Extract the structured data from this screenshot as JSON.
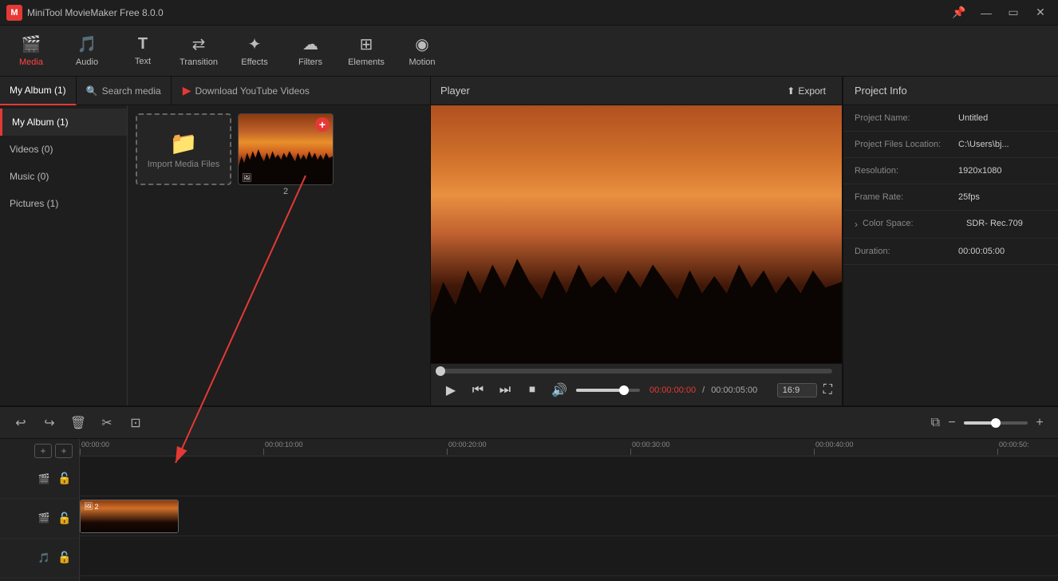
{
  "app": {
    "title": "MiniTool MovieMaker Free 8.0.0",
    "logo": "M"
  },
  "titlebar": {
    "title": "MiniTool MovieMaker Free 8.0.0"
  },
  "toolbar": {
    "items": [
      {
        "id": "media",
        "label": "Media",
        "icon": "🎬",
        "active": true
      },
      {
        "id": "audio",
        "label": "Audio",
        "icon": "🎵",
        "active": false
      },
      {
        "id": "text",
        "label": "Text",
        "icon": "T",
        "active": false
      },
      {
        "id": "transition",
        "label": "Transition",
        "icon": "⇄",
        "active": false
      },
      {
        "id": "effects",
        "label": "Effects",
        "icon": "✦",
        "active": false
      },
      {
        "id": "filters",
        "label": "Filters",
        "icon": "☁",
        "active": false
      },
      {
        "id": "elements",
        "label": "Elements",
        "icon": "⊞",
        "active": false
      },
      {
        "id": "motion",
        "label": "Motion",
        "icon": "◉",
        "active": false
      }
    ]
  },
  "leftpanel": {
    "tabs": [
      {
        "id": "myalbum",
        "label": "My Album (1)",
        "active": true
      },
      {
        "id": "search",
        "label": "Search media",
        "active": false
      },
      {
        "id": "download",
        "label": "Download YouTube Videos",
        "active": false
      }
    ],
    "sidebar": [
      {
        "id": "myalbum",
        "label": "My Album (1)",
        "active": true
      },
      {
        "id": "videos",
        "label": "Videos (0)",
        "active": false
      },
      {
        "id": "music",
        "label": "Music (0)",
        "active": false
      },
      {
        "id": "pictures",
        "label": "Pictures (1)",
        "active": false
      }
    ],
    "import_label": "Import Media Files",
    "media_number": "2"
  },
  "player": {
    "title": "Player",
    "export_label": "Export",
    "time_current": "00:00:00:00",
    "time_total": "00:00:05:00",
    "ratio": "16:9"
  },
  "project_info": {
    "title": "Project Info",
    "fields": [
      {
        "label": "Project Name:",
        "value": "Untitled"
      },
      {
        "label": "Project Files Location:",
        "value": "C:\\Users\\bj..."
      },
      {
        "label": "Resolution:",
        "value": "1920x1080"
      },
      {
        "label": "Frame Rate:",
        "value": "25fps"
      },
      {
        "label": "Color Space:",
        "value": "SDR- Rec.709"
      },
      {
        "label": "Duration:",
        "value": "00:00:05:00"
      }
    ]
  },
  "timeline": {
    "ruler_marks": [
      "00:00:00",
      "00:00:10:00",
      "00:00:20:00",
      "00:00:30:00",
      "00:00:40:00",
      "00:00:50:"
    ],
    "clip_number": "2"
  }
}
